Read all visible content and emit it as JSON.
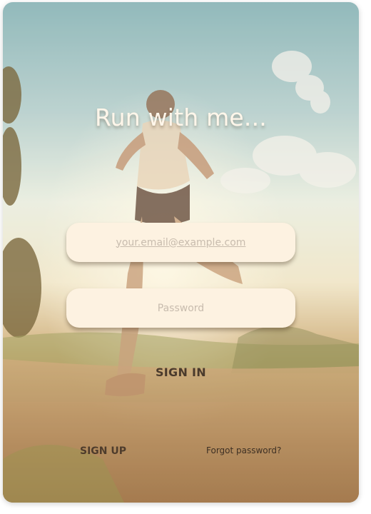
{
  "title": "Run with me...",
  "email": {
    "value": "",
    "placeholder": "your.email@example.com"
  },
  "password": {
    "value": "",
    "placeholder": "Password"
  },
  "sign_in_label": "SIGN IN",
  "sign_up_label": "SIGN UP",
  "forgot_label": "Forgot password?",
  "colors": {
    "field_background": "#fdf2e1",
    "title": "#fff6ea",
    "primary_text": "#4a3a2c"
  }
}
